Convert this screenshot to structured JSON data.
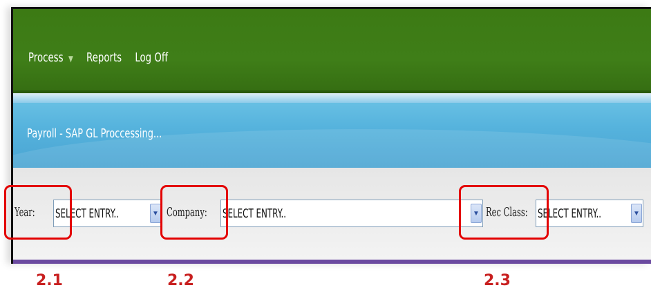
{
  "nav": {
    "items": [
      {
        "label": "Process",
        "has_dropdown": true
      },
      {
        "label": "Reports"
      },
      {
        "label": "Log Off"
      }
    ]
  },
  "banner": {
    "title": "Payroll - SAP GL Proccessing..."
  },
  "filters": {
    "year": {
      "label": "Year:",
      "value": "SELECT ENTRY.."
    },
    "company": {
      "label": "Company:",
      "value": "SELECT ENTRY.."
    },
    "rec_class": {
      "label": "Rec Class:",
      "value": "SELECT ENTRY.."
    }
  },
  "annotations": {
    "step_1": "2.1",
    "step_2": "2.2",
    "step_3": "2.3"
  },
  "colors": {
    "nav_bg": "#3f7e18",
    "banner_bg": "#56b3dd",
    "highlight": "#e30000",
    "step_label": "#c81f1f",
    "frame_bottom": "#6b4aa0"
  },
  "icons": {
    "dropdown_caret": "triangle-down-icon",
    "select_arrow": "chevron-down-icon"
  }
}
